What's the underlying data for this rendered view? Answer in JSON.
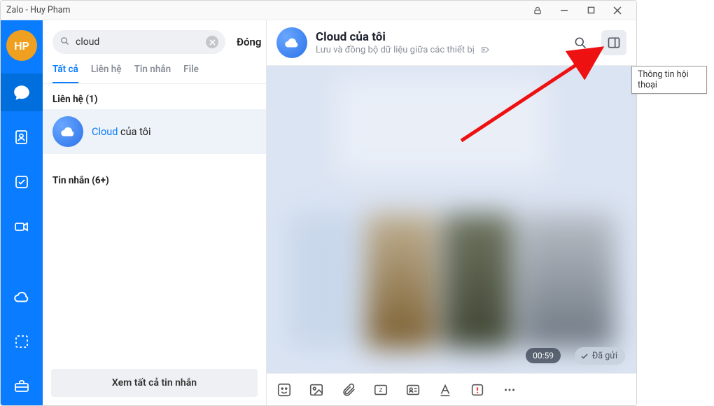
{
  "window": {
    "title": "Zalo - Huy Pham"
  },
  "rail": {
    "avatar_initials": "HP"
  },
  "search": {
    "value": "cloud",
    "cancel_label": "Đóng"
  },
  "tabs": {
    "all": "Tất cả",
    "contacts": "Liên hệ",
    "messages": "Tin nhắn",
    "file": "File"
  },
  "sections": {
    "contacts_header": "Liên hệ (1)",
    "messages_header": "Tin nhắn (6+)"
  },
  "contact": {
    "name_highlight": "Cloud",
    "name_rest": " của tôi"
  },
  "see_all_label": "Xem tất cả tin nhắn",
  "chat": {
    "title": "Cloud của tôi",
    "subtitle": "Lưu và đồng bộ dữ liệu giữa các thiết bị",
    "time": "00:59",
    "status_label": "Đã gửi"
  },
  "tooltip_panel_info": "Thông tin hội thoại"
}
